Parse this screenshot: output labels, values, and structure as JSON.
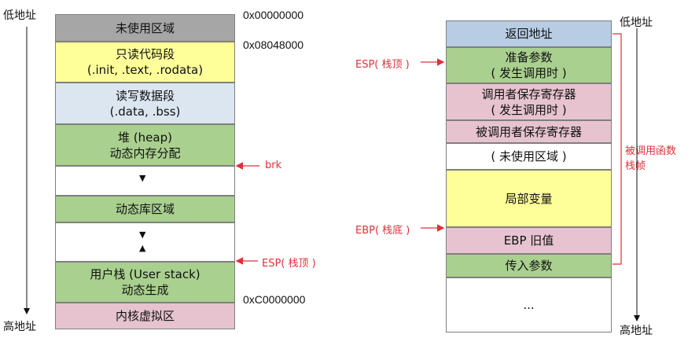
{
  "left": {
    "top_label": "低地址",
    "bottom_label": "高地址",
    "segments": [
      {
        "line1": "未使用区域",
        "line2": "",
        "color": "#a6a6a6"
      },
      {
        "line1": "只读代码段",
        "line2": "(.init, .text, .rodata)",
        "color": "#ffff99"
      },
      {
        "line1": "读写数据段",
        "line2": "(.data, .bss)",
        "color": "#dce6f1"
      },
      {
        "line1": "堆 (heap)",
        "line2": "动态内存分配",
        "color": "#a9d08e"
      },
      {
        "line1": "",
        "line2": "",
        "color": "#ffffff"
      },
      {
        "line1": "动态库区域",
        "line2": "",
        "color": "#a9d08e"
      },
      {
        "line1": "",
        "line2": "",
        "color": "#ffffff"
      },
      {
        "line1": "用户栈 (User stack)",
        "line2": "动态生成",
        "color": "#a9d08e"
      },
      {
        "line1": "内核虚拟区",
        "line2": "",
        "color": "#e6c3cf"
      }
    ],
    "addresses": [
      "0x00000000",
      "0x08048000",
      "0xC0000000"
    ],
    "markers": [
      "brk",
      "ESP( 栈顶 )"
    ],
    "arrow_glyphs": [
      "▼",
      "▼",
      "▲"
    ]
  },
  "right": {
    "top_label": "低地址",
    "bottom_label": "高地址",
    "frames": [
      {
        "line1": "返回地址",
        "line2": "",
        "color": "#b8cce4"
      },
      {
        "line1": "准备参数",
        "line2": "( 发生调用时 )",
        "color": "#a9d08e"
      },
      {
        "line1": "调用者保存寄存器",
        "line2": "( 发生调用时 )",
        "color": "#e6c3cf"
      },
      {
        "line1": "被调用者保存寄存器",
        "line2": "",
        "color": "#e6c3cf"
      },
      {
        "line1": "( 未使用区域 )",
        "line2": "",
        "color": "#ffffff"
      },
      {
        "line1": "局部变量",
        "line2": "",
        "color": "#ffff99"
      },
      {
        "line1": "EBP 旧值",
        "line2": "",
        "color": "#e6c3cf"
      },
      {
        "line1": "传入参数",
        "line2": "",
        "color": "#a9d08e"
      },
      {
        "line1": "...",
        "line2": "",
        "color": "#ffffff"
      }
    ],
    "markers": [
      "ESP( 栈顶 )",
      "EBP( 栈底 )"
    ],
    "brace_label_line1": "被调用函数",
    "brace_label_line2": "栈帧"
  }
}
